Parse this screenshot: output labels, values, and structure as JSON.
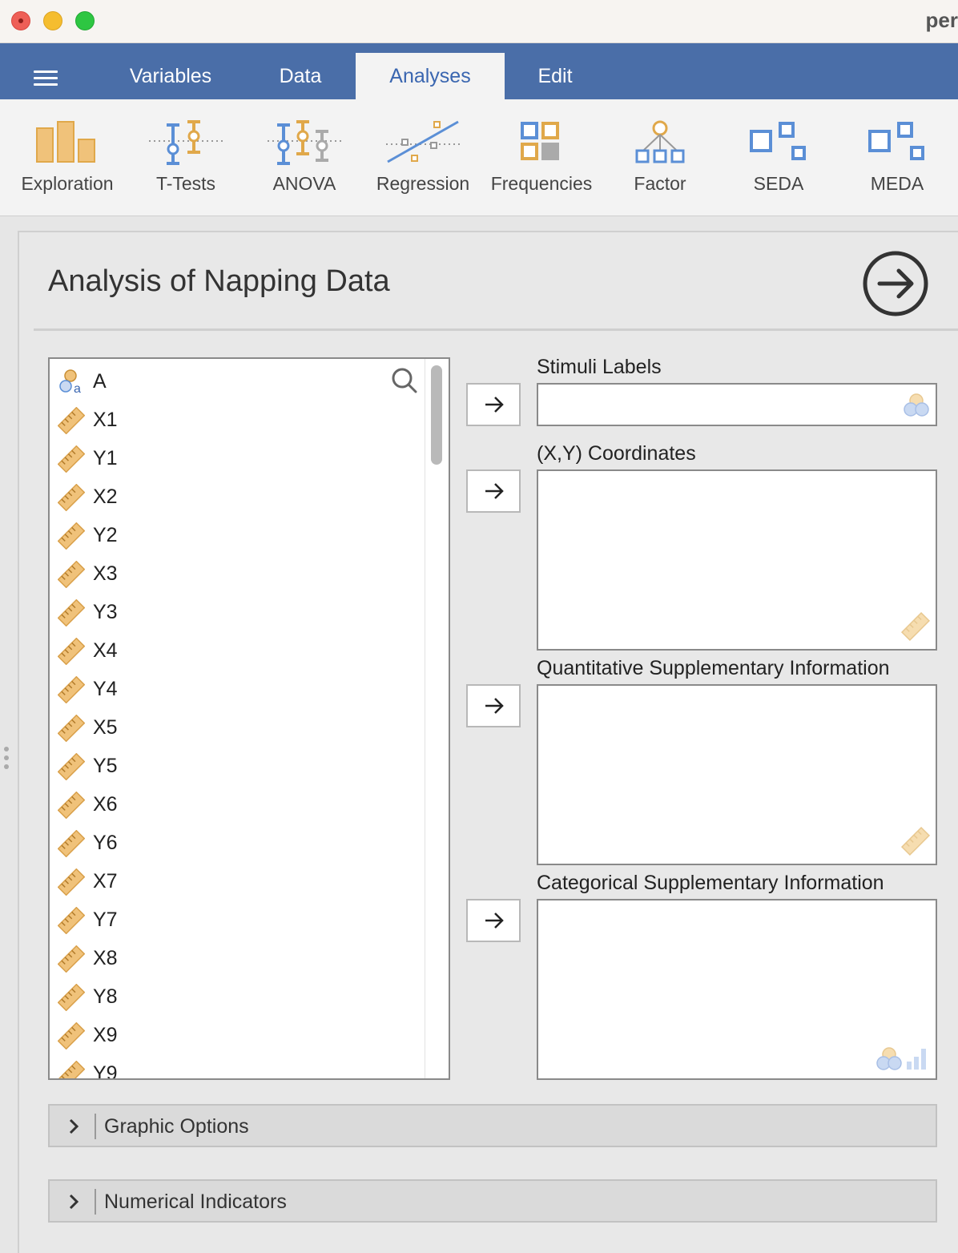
{
  "window": {
    "title": "per"
  },
  "tabs": [
    {
      "label": "Variables"
    },
    {
      "label": "Data"
    },
    {
      "label": "Analyses",
      "active": true
    },
    {
      "label": "Edit"
    }
  ],
  "ribbon": [
    {
      "label": "Exploration",
      "icon": "exploration-icon"
    },
    {
      "label": "T-Tests",
      "icon": "t-tests-icon"
    },
    {
      "label": "ANOVA",
      "icon": "anova-icon"
    },
    {
      "label": "Regression",
      "icon": "regression-icon"
    },
    {
      "label": "Frequencies",
      "icon": "frequencies-icon"
    },
    {
      "label": "Factor",
      "icon": "factor-icon"
    },
    {
      "label": "SEDA",
      "icon": "seda-icon"
    },
    {
      "label": "MEDA",
      "icon": "meda-icon"
    }
  ],
  "analysis": {
    "title": "Analysis of Napping Data",
    "variables": [
      {
        "name": "A",
        "type": "nominal-text"
      },
      {
        "name": "X1",
        "type": "continuous"
      },
      {
        "name": "Y1",
        "type": "continuous"
      },
      {
        "name": "X2",
        "type": "continuous"
      },
      {
        "name": "Y2",
        "type": "continuous"
      },
      {
        "name": "X3",
        "type": "continuous"
      },
      {
        "name": "Y3",
        "type": "continuous"
      },
      {
        "name": "X4",
        "type": "continuous"
      },
      {
        "name": "Y4",
        "type": "continuous"
      },
      {
        "name": "X5",
        "type": "continuous"
      },
      {
        "name": "Y5",
        "type": "continuous"
      },
      {
        "name": "X6",
        "type": "continuous"
      },
      {
        "name": "Y6",
        "type": "continuous"
      },
      {
        "name": "X7",
        "type": "continuous"
      },
      {
        "name": "Y7",
        "type": "continuous"
      },
      {
        "name": "X8",
        "type": "continuous"
      },
      {
        "name": "Y8",
        "type": "continuous"
      },
      {
        "name": "X9",
        "type": "continuous"
      },
      {
        "name": "Y9",
        "type": "continuous"
      }
    ],
    "targets": {
      "stimuli": {
        "label": "Stimuli Labels"
      },
      "coords": {
        "label": "(X,Y) Coordinates"
      },
      "quant": {
        "label": "Quantitative Supplementary Information"
      },
      "categ": {
        "label": "Categorical Supplementary Information"
      }
    },
    "sections": {
      "graphic": {
        "label": "Graphic Options"
      },
      "numerical": {
        "label": "Numerical Indicators"
      }
    }
  },
  "colors": {
    "tabbar": "#4a6ea8",
    "accent": "#3a66b0",
    "ruler": "#e6a94a",
    "nominal_blue": "#5b8fd6"
  }
}
